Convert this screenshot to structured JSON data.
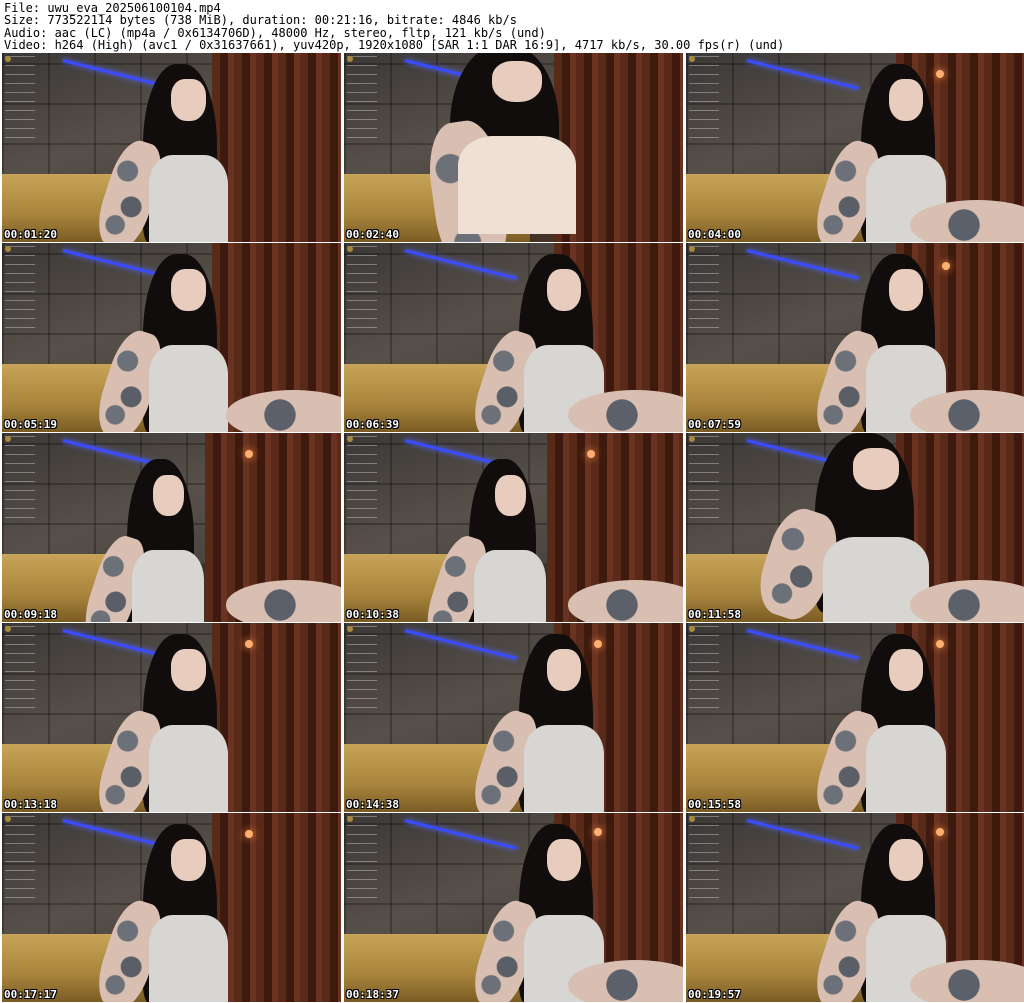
{
  "header": {
    "file": "File: uwu_eva_202506100104.mp4",
    "size": "Size: 773522114 bytes (738 MiB), duration: 00:21:16, bitrate: 4846 kb/s",
    "audio": "Audio: aac (LC) (mp4a / 0x6134706D), 48000 Hz, stereo, fltp, 121 kb/s (und)",
    "video": "Video: h264 (High) (avc1 / 0x31637661), yuv420p, 1920x1080 [SAR 1:1 DAR 16:9], 4717 kb/s, 30.00 fps(r) (und)"
  },
  "frames": [
    {
      "timestamp": "00:01:20"
    },
    {
      "timestamp": "00:02:40"
    },
    {
      "timestamp": "00:04:00"
    },
    {
      "timestamp": "00:05:19"
    },
    {
      "timestamp": "00:06:39"
    },
    {
      "timestamp": "00:07:59"
    },
    {
      "timestamp": "00:09:18"
    },
    {
      "timestamp": "00:10:38"
    },
    {
      "timestamp": "00:11:58"
    },
    {
      "timestamp": "00:13:18"
    },
    {
      "timestamp": "00:14:38"
    },
    {
      "timestamp": "00:15:58"
    },
    {
      "timestamp": "00:17:17"
    },
    {
      "timestamp": "00:18:37"
    },
    {
      "timestamp": "00:19:57"
    }
  ]
}
